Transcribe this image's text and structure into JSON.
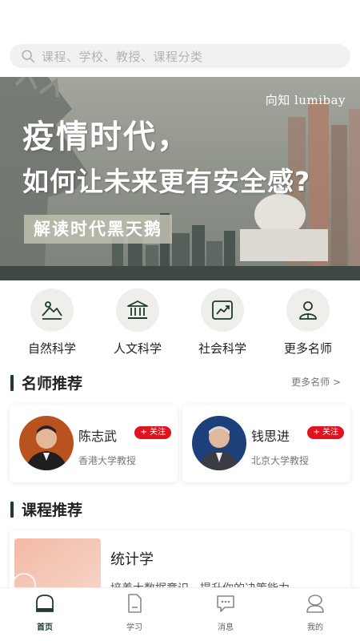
{
  "search": {
    "placeholder": "课程、学校、教授、课程分类",
    "icon": "search-icon"
  },
  "banner": {
    "brand": "向知 lumibay",
    "title_line1": "疫情时代，",
    "title_line2": "如何让未来更有安全感?",
    "tag": "解读时代黑天鹅"
  },
  "categories": [
    {
      "label": "自然科学",
      "icon": "mountain-landscape-icon"
    },
    {
      "label": "人文科学",
      "icon": "museum-building-icon"
    },
    {
      "label": "社会科学",
      "icon": "trend-chart-icon"
    },
    {
      "label": "更多名师",
      "icon": "teacher-person-icon"
    }
  ],
  "teachers_section": {
    "title": "名师推荐",
    "more": "更多名师 >"
  },
  "teachers": [
    {
      "name": "陈志武",
      "school": "香港大学教授",
      "follow": "+ 关注"
    },
    {
      "name": "钱思进",
      "school": "北京大学教授",
      "follow": "+ 关注"
    }
  ],
  "courses_section": {
    "title": "课程推荐"
  },
  "courses": [
    {
      "title": "统计学",
      "desc": "培养大数据意识，提升你的决策能力"
    }
  ],
  "tabs": [
    {
      "label": "首页",
      "icon": "home-icon",
      "active": true
    },
    {
      "label": "学习",
      "icon": "document-icon",
      "active": false
    },
    {
      "label": "消息",
      "icon": "message-bubble-icon",
      "active": false
    },
    {
      "label": "我的",
      "icon": "profile-icon",
      "active": false
    }
  ],
  "colors": {
    "accent": "#1f3a2f",
    "follow_red": "#e0141e",
    "search_bg": "#f1f1f1"
  }
}
